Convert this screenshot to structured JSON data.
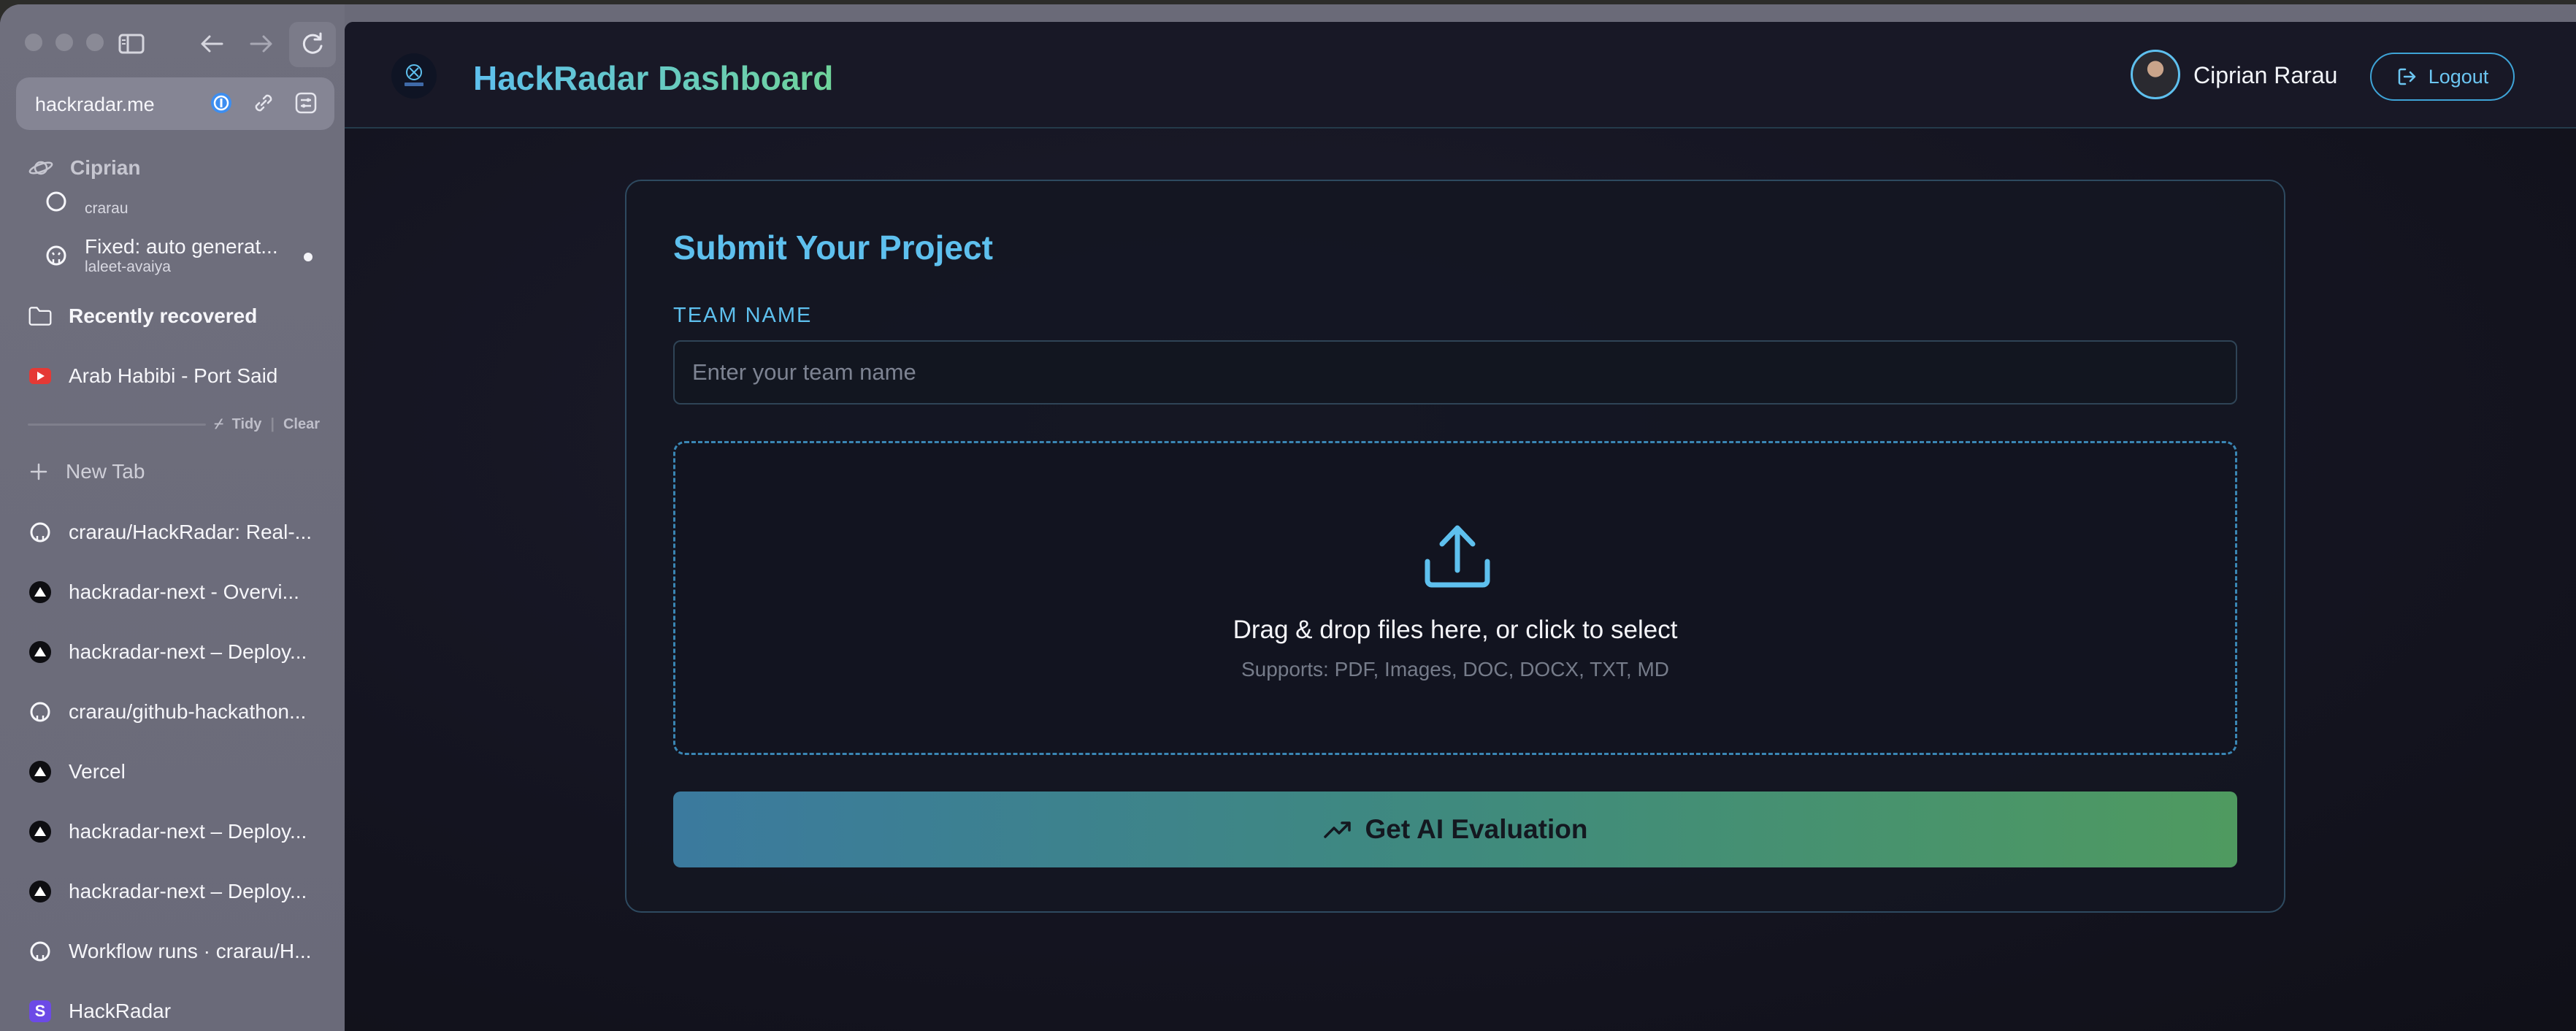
{
  "browser": {
    "url": "hackradar.me",
    "space_name": "Ciprian",
    "tabs_top": [
      {
        "title": "",
        "subtitle": "crarau",
        "icon": "github-icon"
      },
      {
        "title": "Fixed: auto generat...",
        "subtitle": "laleet-avaiya",
        "icon": "github-icon"
      }
    ],
    "folder": {
      "title": "Recently recovered",
      "icon": "folder-icon"
    },
    "pinned_tab": {
      "title": "Arab Habibi - Port Said",
      "icon": "youtube-icon"
    },
    "tidy_label": "Tidy",
    "clear_label": "Clear",
    "new_tab_label": "New Tab",
    "tabs": [
      {
        "title": "crarau/HackRadar: Real-...",
        "icon": "github-icon"
      },
      {
        "title": "hackradar-next - Overvi...",
        "icon": "vercel-icon"
      },
      {
        "title": "hackradar-next – Deploy...",
        "icon": "vercel-icon"
      },
      {
        "title": "crarau/github-hackathon...",
        "icon": "github-icon"
      },
      {
        "title": "Vercel",
        "icon": "vercel-icon"
      },
      {
        "title": "hackradar-next – Deploy...",
        "icon": "vercel-icon"
      },
      {
        "title": "hackradar-next – Deploy...",
        "icon": "vercel-icon"
      },
      {
        "title": "Workflow runs · crarau/H...",
        "icon": "github-icon"
      },
      {
        "title": "HackRadar",
        "icon": "s-icon"
      }
    ]
  },
  "app": {
    "title": "HackRadar Dashboard",
    "user_name": "Ciprian Rarau",
    "logout_label": "Logout",
    "card": {
      "title": "Submit Your Project",
      "team_label": "TEAM NAME",
      "team_placeholder": "Enter your team name",
      "team_value": "",
      "drop_title": "Drag & drop files here, or click to select",
      "drop_subtitle": "Supports: PDF, Images, DOC, DOCX, TXT, MD",
      "submit_label": "Get AI Evaluation"
    }
  },
  "colors": {
    "accent_blue": "#5ec0ee",
    "accent_green": "#6fd39a",
    "dropzone_border": "#3a86b4"
  }
}
